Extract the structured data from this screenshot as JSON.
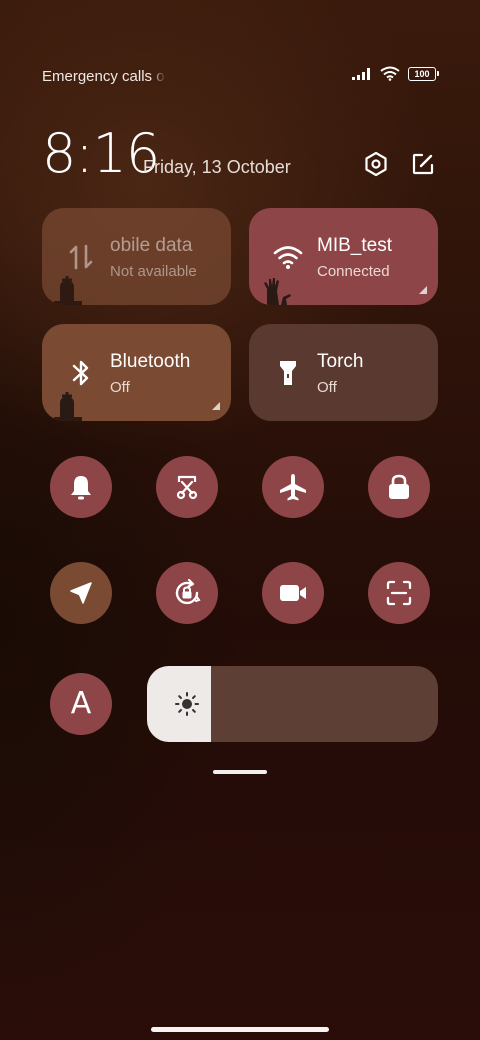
{
  "status_bar": {
    "carrier_text": "Emergency calls o",
    "battery_level": "100",
    "icons": [
      "signal-bars-icon",
      "wifi-icon",
      "battery-icon"
    ]
  },
  "header": {
    "time": "8:16",
    "date": "Friday, 13 October",
    "icons": [
      "settings-hexagon-icon",
      "edit-icon"
    ]
  },
  "tiles": {
    "mobile_data": {
      "title": "obile data",
      "subtitle": "Not available",
      "icon": "mobile-data-arrows-icon",
      "color": "#7a4a33"
    },
    "wifi": {
      "title": "MIB_test",
      "subtitle": "Connected",
      "icon": "wifi-icon",
      "color": "#8e4548"
    },
    "bluetooth": {
      "title": "Bluetooth",
      "subtitle": "Off",
      "icon": "bluetooth-icon",
      "color": "#7a4a33"
    },
    "torch": {
      "title": "Torch",
      "subtitle": "Off",
      "icon": "flashlight-icon",
      "color": "#5a3a30"
    }
  },
  "quick_toggles": {
    "row1": [
      "bell-icon",
      "screenshot-scissors-icon",
      "airplane-icon",
      "lock-icon"
    ],
    "row2": [
      "location-arrow-icon",
      "rotation-lock-icon",
      "video-camera-icon",
      "scan-icon"
    ],
    "row3": [
      "auto-brightness-A-icon"
    ],
    "auto_brightness_label": "A"
  },
  "brightness": {
    "level_percent": 22,
    "icon": "sun-icon"
  },
  "colors": {
    "accent_red": "#8e4548",
    "accent_brown": "#7a4a33",
    "torch_tile": "#5a3a30"
  }
}
